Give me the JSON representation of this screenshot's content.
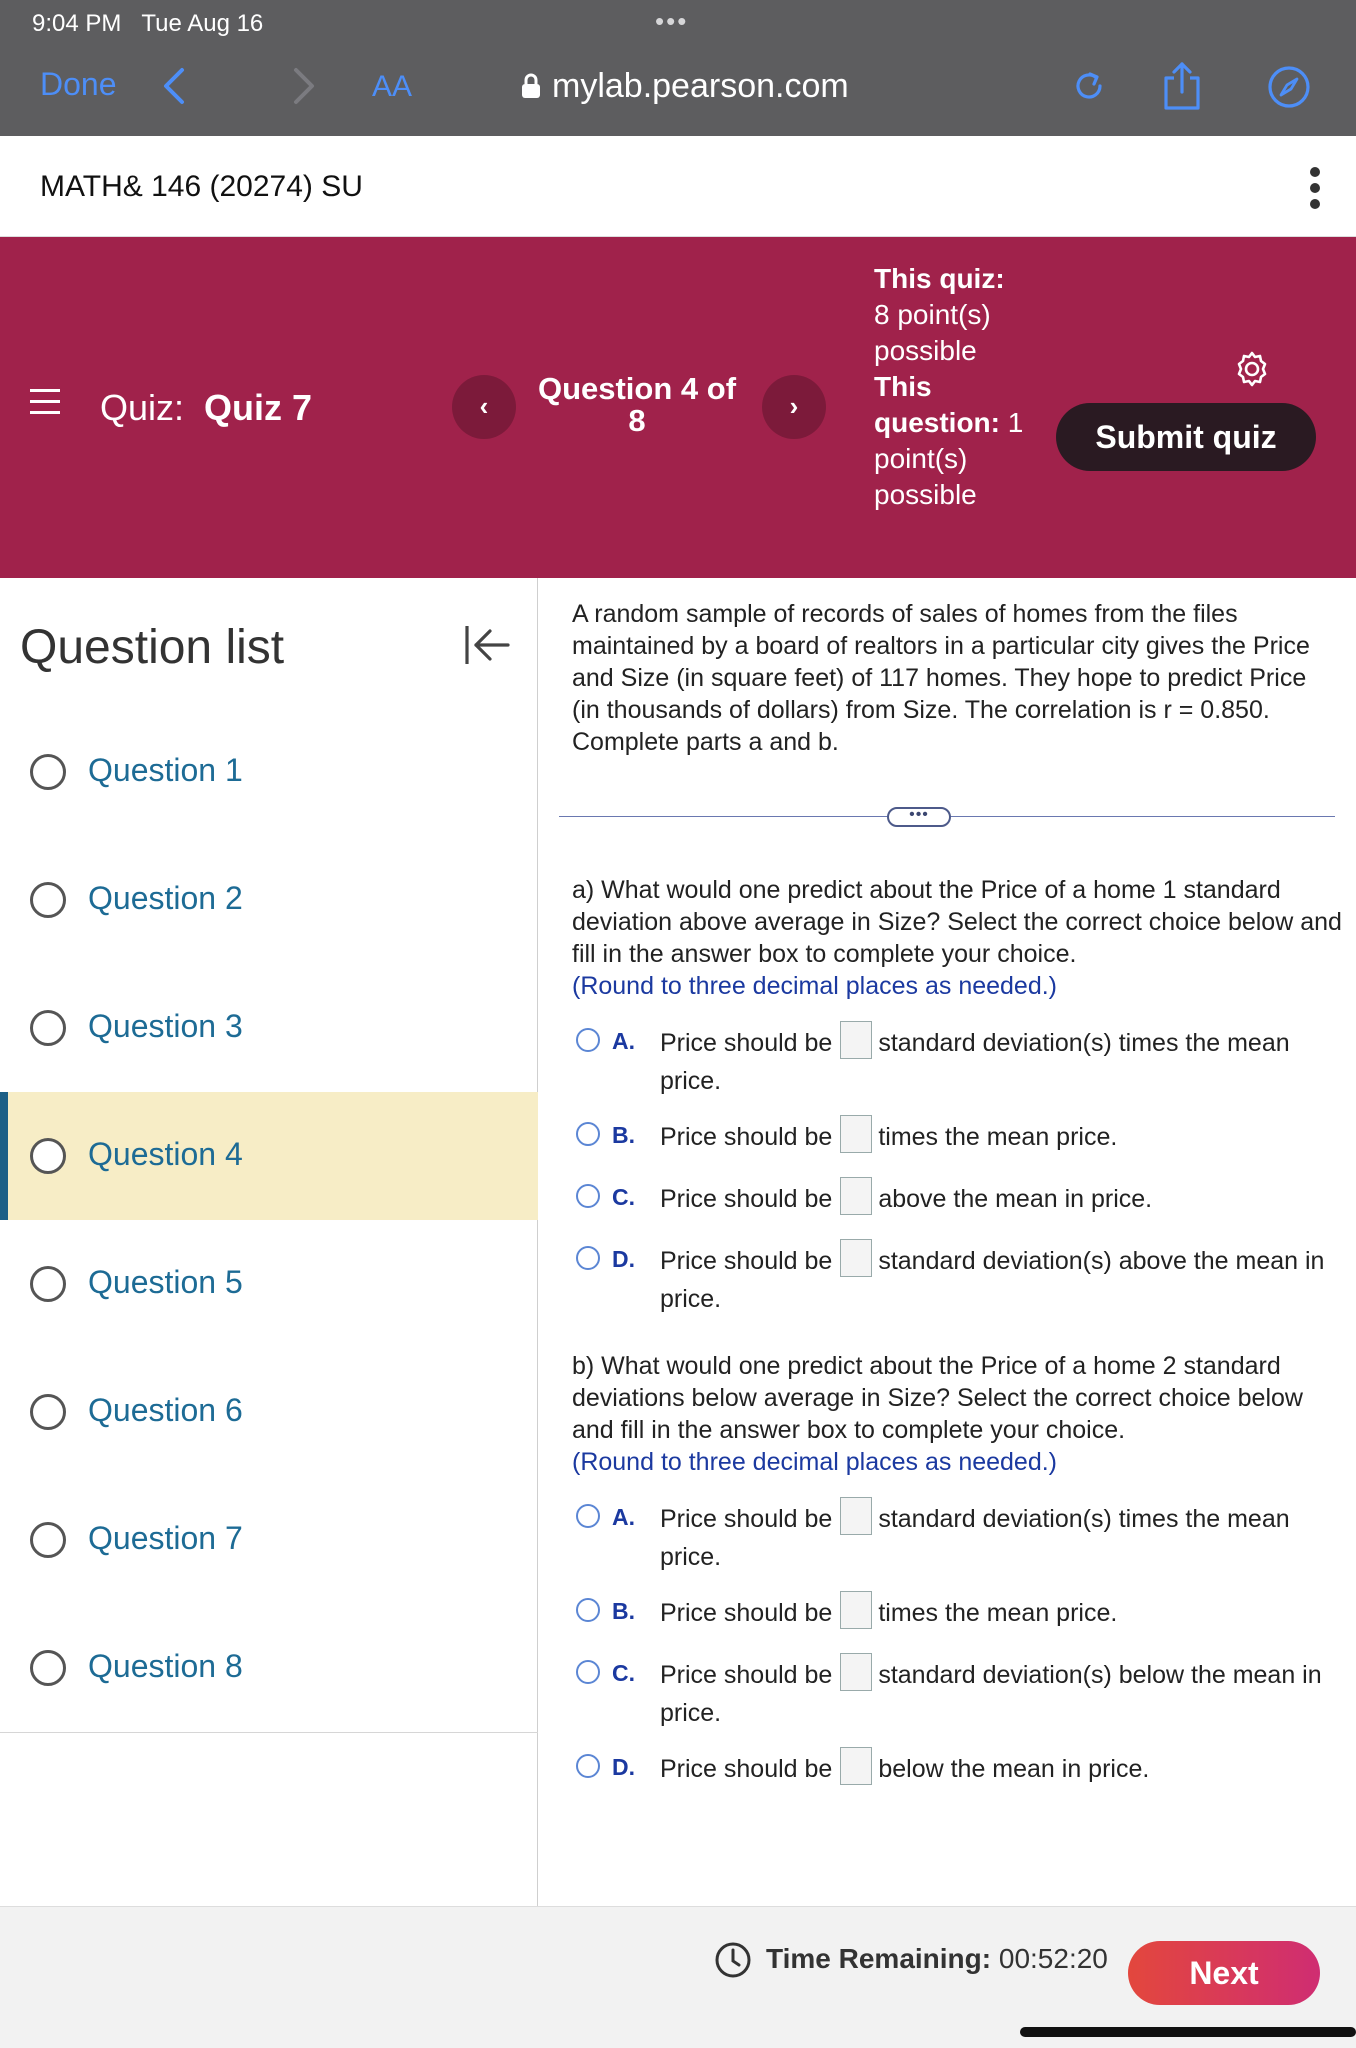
{
  "browser": {
    "time": "9:04 PM",
    "date": "Tue Aug 16",
    "done_label": "Done",
    "aa_label": "AA",
    "url": "mylab.pearson.com"
  },
  "course": {
    "title": "MATH& 146 (20274) SU"
  },
  "header": {
    "quiz_prefix": "Quiz:",
    "quiz_name": "Quiz 7",
    "question_counter": "Question 4 of 8",
    "this_quiz_label": "This quiz:",
    "this_quiz_points": "8 point(s) possible",
    "this_question_label": "This question:",
    "this_question_points": "1 point(s) possible",
    "submit_label": "Submit quiz",
    "prev_glyph": "‹",
    "next_glyph": "›"
  },
  "sidebar": {
    "title": "Question list",
    "items": [
      {
        "label": "Question 1"
      },
      {
        "label": "Question 2"
      },
      {
        "label": "Question 3"
      },
      {
        "label": "Question 4",
        "active": true
      },
      {
        "label": "Question 5"
      },
      {
        "label": "Question 6"
      },
      {
        "label": "Question 7"
      },
      {
        "label": "Question 8"
      }
    ]
  },
  "question": {
    "intro": "A random sample of records of sales of homes from the files maintained by a board of realtors in a particular city gives the Price and Size (in square feet) of 117 homes. They hope to predict Price (in thousands of dollars) from Size. The correlation is r = 0.850. Complete parts a and b.",
    "more_label": "•••",
    "part_a": {
      "text": "a) What would one predict about the Price of a home 1 standard deviation above average in Size? Select the correct choice below and fill in the answer box to complete your choice.",
      "round": "(Round to three decimal places as needed.)",
      "choices": [
        {
          "letter": "A.",
          "pre": "Price should be",
          "post": "standard deviation(s) times the mean price."
        },
        {
          "letter": "B.",
          "pre": "Price should be",
          "post": "times the mean price."
        },
        {
          "letter": "C.",
          "pre": "Price should be",
          "post": "above the mean in price."
        },
        {
          "letter": "D.",
          "pre": "Price should be",
          "post": "standard deviation(s) above the mean in price."
        }
      ]
    },
    "part_b": {
      "text": "b) What would one predict about the Price of a home 2 standard deviations below average in Size? Select the correct choice below and fill in the answer box to complete your choice.",
      "round": "(Round to three decimal places as needed.)",
      "choices": [
        {
          "letter": "A.",
          "pre": "Price should be",
          "post": "standard deviation(s) times the mean price."
        },
        {
          "letter": "B.",
          "pre": "Price should be",
          "post": "times the mean price."
        },
        {
          "letter": "C.",
          "pre": "Price should be",
          "post": "standard deviation(s) below the mean in price."
        },
        {
          "letter": "D.",
          "pre": "Price should be",
          "post": "below the mean in price."
        }
      ]
    }
  },
  "footer": {
    "time_label": "Time Remaining:",
    "time_value": "00:52:20",
    "next_label": "Next"
  },
  "colors": {
    "header_bg": "#a0224b",
    "link_blue": "#1d6b95",
    "active_bg": "#f7edc6",
    "safari_accent": "#4d8ef7"
  }
}
